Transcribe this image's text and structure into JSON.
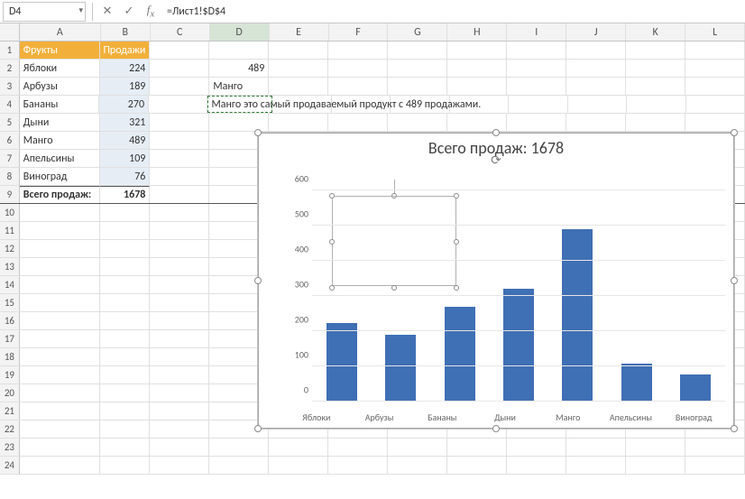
{
  "namebox": {
    "value": "D4"
  },
  "formula": {
    "value": "=Лист1!$D$4"
  },
  "columns": [
    "A",
    "B",
    "C",
    "D",
    "E",
    "F",
    "G",
    "H",
    "I",
    "J",
    "K",
    "L"
  ],
  "table": {
    "header": {
      "a": "Фрукты",
      "b": "Продажи"
    },
    "rows": [
      {
        "a": "Яблоки",
        "b": "224"
      },
      {
        "a": "Арбузы",
        "b": "189"
      },
      {
        "a": "Бананы",
        "b": "270"
      },
      {
        "a": "Дыни",
        "b": "321"
      },
      {
        "a": "Манго",
        "b": "489"
      },
      {
        "a": "Апельсины",
        "b": "109"
      },
      {
        "a": "Виноград",
        "b": "76"
      }
    ],
    "total": {
      "a": "Всего продаж:",
      "b": "1678"
    }
  },
  "cells": {
    "d2": "489",
    "d3": "Манго",
    "d4": "Манго это самый продаваемый продукт с 489 продажами."
  },
  "chart": {
    "title": "Всего продаж: 1678"
  },
  "chart_data": {
    "type": "bar",
    "categories": [
      "Яблоки",
      "Арбузы",
      "Бананы",
      "Дыни",
      "Манго",
      "Апельсины",
      "Виноград"
    ],
    "values": [
      224,
      189,
      270,
      321,
      489,
      109,
      76
    ],
    "title": "Всего продаж: 1678",
    "xlabel": "",
    "ylabel": "",
    "yticks": [
      0,
      100,
      200,
      300,
      400,
      500,
      600
    ],
    "ylim": [
      0,
      600
    ]
  }
}
